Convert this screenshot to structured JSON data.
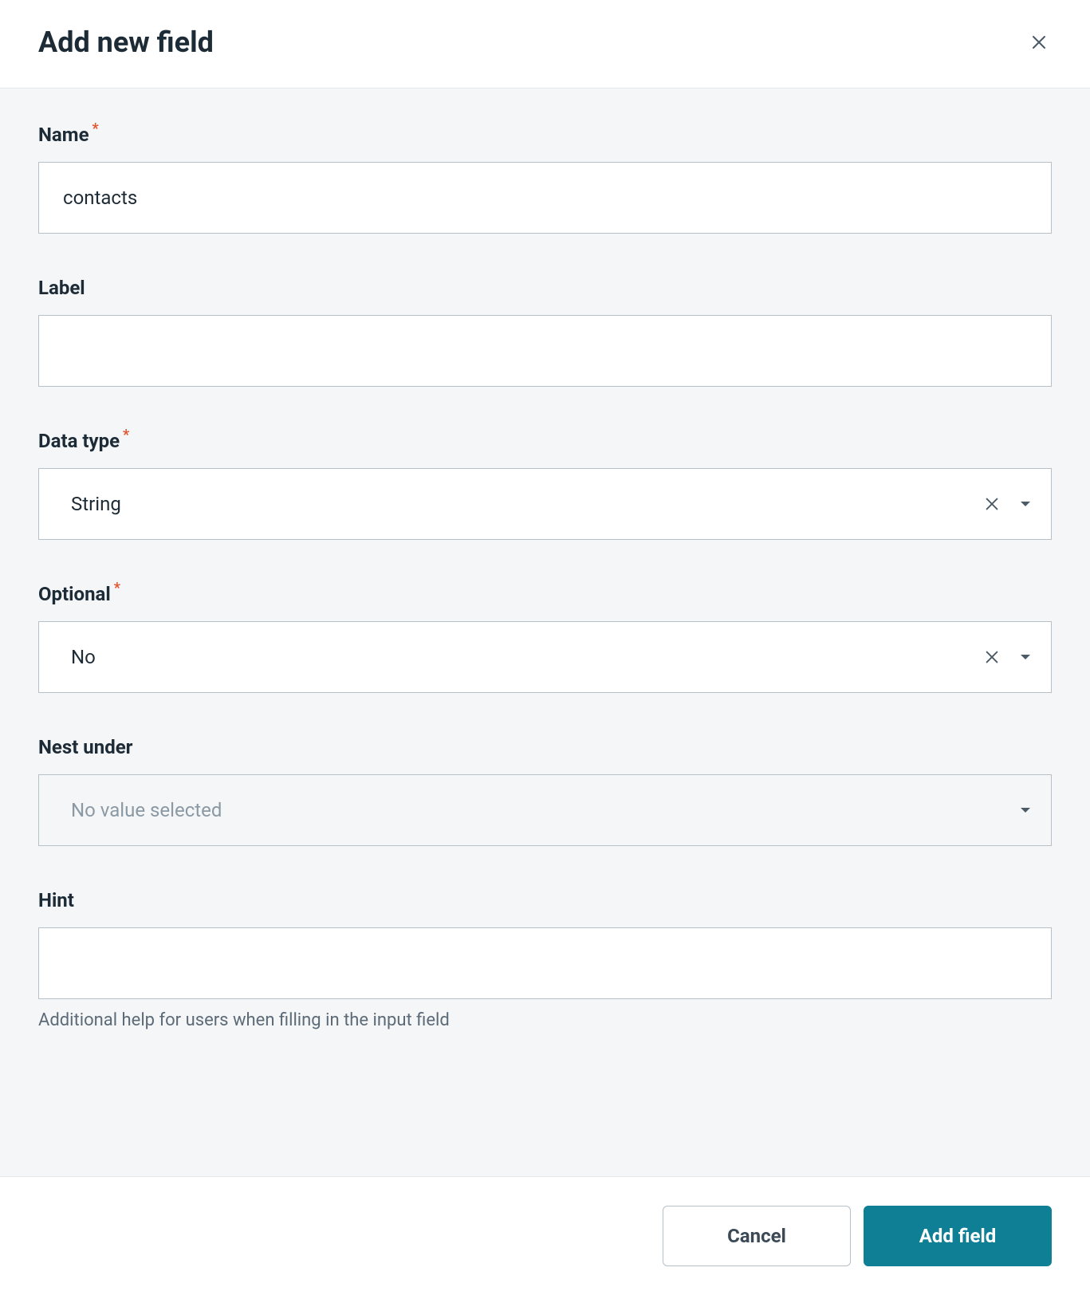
{
  "header": {
    "title": "Add new field"
  },
  "form": {
    "name": {
      "label": "Name",
      "value": "contacts",
      "required": true
    },
    "label_field": {
      "label": "Label",
      "value": ""
    },
    "data_type": {
      "label": "Data type",
      "value": "String",
      "required": true
    },
    "optional": {
      "label": "Optional",
      "value": "No",
      "required": true
    },
    "nest_under": {
      "label": "Nest under",
      "placeholder": "No value selected"
    },
    "hint": {
      "label": "Hint",
      "value": "",
      "help": "Additional help for users when filling in the input field"
    }
  },
  "footer": {
    "cancel": "Cancel",
    "submit": "Add field"
  }
}
